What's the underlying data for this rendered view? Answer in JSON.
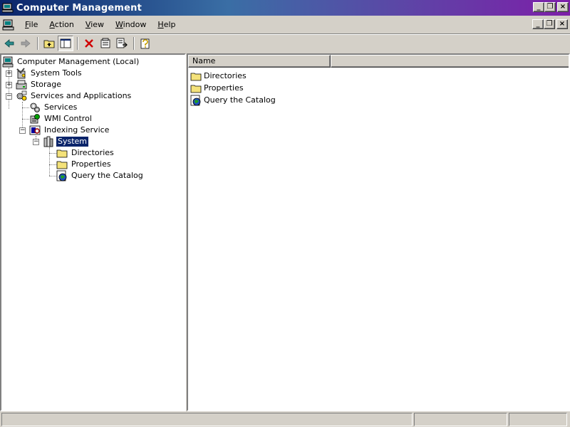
{
  "window": {
    "title": "Computer Management"
  },
  "menu": [
    {
      "label": "File",
      "ul": "F",
      "rest": "ile"
    },
    {
      "label": "Action",
      "ul": "A",
      "rest": "ction"
    },
    {
      "label": "View",
      "ul": "V",
      "rest": "iew"
    },
    {
      "label": "Window",
      "ul": "W",
      "rest": "indow"
    },
    {
      "label": "Help",
      "ul": "H",
      "rest": "elp"
    }
  ],
  "toolbar": {
    "buttons": [
      "back-arrow-icon",
      "forward-arrow-icon",
      "up-folder-icon",
      "show-hide-tree-icon",
      "delete-icon",
      "properties-icon",
      "export-list-icon",
      "help-icon"
    ]
  },
  "tree": {
    "root": "Computer Management (Local)",
    "system_tools": "System Tools",
    "storage": "Storage",
    "services_apps": "Services and Applications",
    "services": "Services",
    "wmi": "WMI Control",
    "indexing": "Indexing Service",
    "system": "System",
    "directories": "Directories",
    "properties": "Properties",
    "query": "Query the Catalog"
  },
  "list": {
    "column_name": "Name",
    "items": [
      "Directories",
      "Properties",
      "Query the Catalog"
    ]
  },
  "colors": {
    "title_start": "#0a246a",
    "title_end": "#7d1fa8",
    "selection": "#0a246a",
    "face": "#d4d0c8"
  }
}
